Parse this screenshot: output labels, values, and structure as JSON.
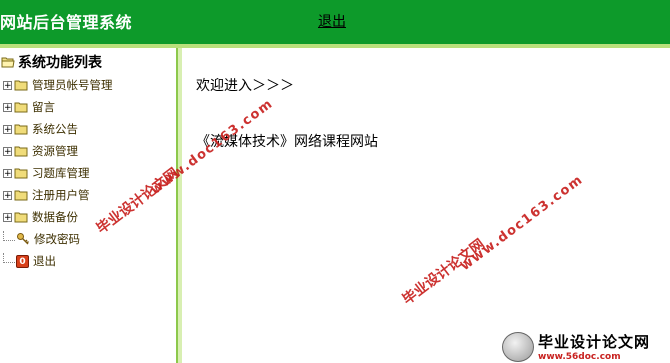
{
  "header": {
    "title": "网站后台管理系统",
    "logout_label": "退出"
  },
  "sidebar": {
    "title": "系统功能列表",
    "items": [
      {
        "label": "管理员帐号管理",
        "icon": "folder-icon"
      },
      {
        "label": "留言",
        "icon": "folder-icon"
      },
      {
        "label": "系统公告",
        "icon": "folder-icon"
      },
      {
        "label": "资源管理",
        "icon": "folder-icon"
      },
      {
        "label": "习题库管理",
        "icon": "folder-icon"
      },
      {
        "label": "注册用户管",
        "icon": "folder-icon"
      },
      {
        "label": "数据备份",
        "icon": "folder-icon"
      },
      {
        "label": "修改密码",
        "icon": "key-icon"
      },
      {
        "label": "退出",
        "icon": "exit-icon"
      }
    ]
  },
  "main": {
    "welcome": "欢迎进入＞＞＞",
    "site_name": "《流媒体技术》网络课程网站"
  },
  "watermarks": [
    {
      "text": "毕业设计论文网"
    },
    {
      "text": "www.doc163.com"
    }
  ],
  "banner": {
    "title": "毕业设计论文网",
    "url": "www.56doc.com"
  },
  "colors": {
    "header_bg": "#0d9a2a",
    "border_light_green": "#b9e07c",
    "watermark_red": "#c8211f"
  }
}
